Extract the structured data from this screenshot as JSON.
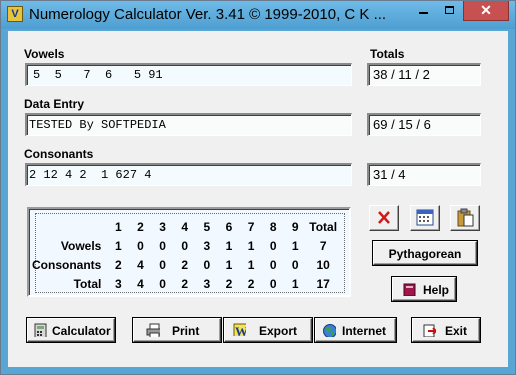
{
  "window": {
    "title": "Numerology Calculator Ver. 3.41 © 1999-2010, C K ...",
    "icon_letter": "V"
  },
  "labels": {
    "vowels": "Vowels",
    "data_entry": "Data Entry",
    "consonants": "Consonants",
    "totals": "Totals"
  },
  "fields": {
    "vowels": "5  5   7  6   5 91",
    "data_entry": "TESTED By SOFTPEDIA",
    "consonants": "2 12 4 2  1 627 4",
    "vowels_total": "38 / 11 / 2",
    "entry_total": "69 / 15 / 6",
    "consonants_total": "31 / 4"
  },
  "table": {
    "headers": [
      "1",
      "2",
      "3",
      "4",
      "5",
      "6",
      "7",
      "8",
      "9",
      "Total"
    ],
    "rows": [
      {
        "label": "Vowels",
        "values": [
          "1",
          "0",
          "0",
          "0",
          "3",
          "1",
          "1",
          "0",
          "1",
          "7"
        ]
      },
      {
        "label": "Consonants",
        "values": [
          "2",
          "4",
          "0",
          "2",
          "0",
          "1",
          "1",
          "0",
          "0",
          "10"
        ]
      },
      {
        "label": "Total",
        "values": [
          "3",
          "4",
          "0",
          "2",
          "3",
          "2",
          "2",
          "0",
          "1",
          "17"
        ]
      }
    ]
  },
  "buttons": {
    "pythagorean": "Pythagorean",
    "help": "Help",
    "calculator": "Calculator",
    "print": "Print",
    "export": "Export",
    "internet": "Internet",
    "exit": "Exit"
  },
  "icons": {
    "clear": "red-x-icon",
    "calendar": "calendar-icon",
    "paste": "clipboard-icon"
  },
  "colors": {
    "titlebar": "#59a6d4",
    "close": "#c75050",
    "field_bg": "#fafbfb",
    "table_bg": "#f2f8ff"
  }
}
